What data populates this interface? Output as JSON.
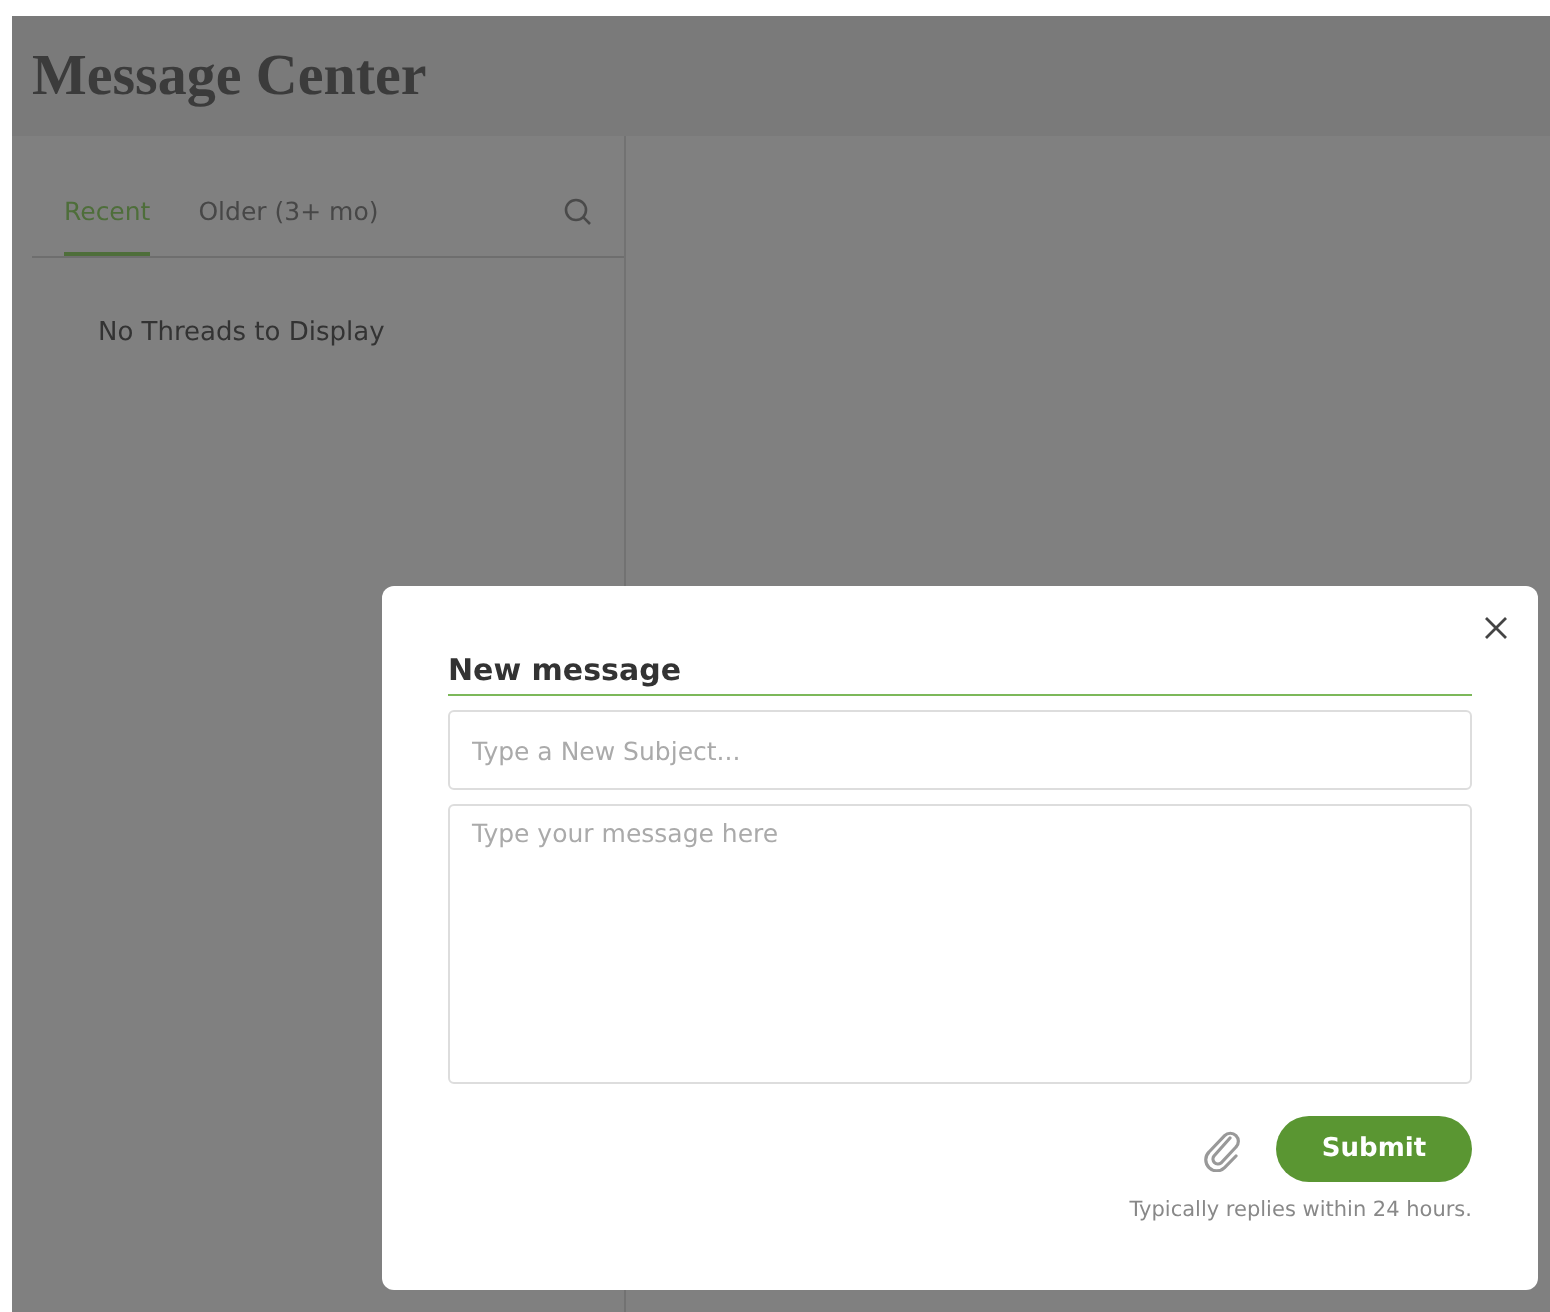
{
  "page": {
    "title": "Message Center"
  },
  "thread_list": {
    "tabs": [
      {
        "label": "Recent",
        "selected": true
      },
      {
        "label": "Older (3+ mo)",
        "selected": false
      }
    ],
    "empty_message": "No Threads to Display"
  },
  "dialog": {
    "title": "New message",
    "subject": {
      "placeholder": "Type a New Subject..."
    },
    "body": {
      "placeholder": "Type your message here"
    },
    "submit_label": "Submit",
    "note": "Typically replies within 24 hours."
  }
}
